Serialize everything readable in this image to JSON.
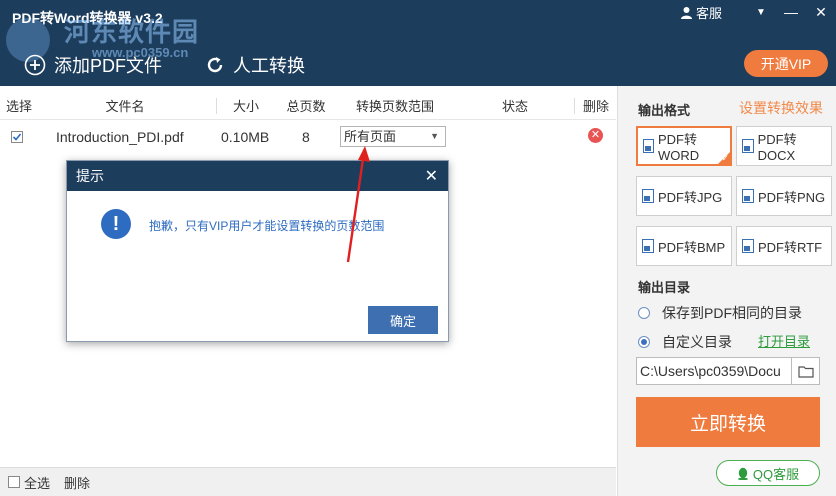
{
  "app": {
    "title": "PDF转Word转换器 v3.2",
    "watermark": "河东软件园",
    "watermark_url": "www.pc0359.cn"
  },
  "titlebar": {
    "kefu_label": "客服",
    "menu_icon": "▼",
    "minimize_icon": "—",
    "close_icon": "✕"
  },
  "toolbar": {
    "add_pdf_label": "添加PDF文件",
    "manual_convert_label": "人工转换",
    "vip_label": "开通VIP"
  },
  "table": {
    "headers": [
      "选择",
      "文件名",
      "大小",
      "总页数",
      "转换页数范围",
      "状态",
      "删除"
    ],
    "rows": [
      {
        "checked": true,
        "filename": "Introduction_PDI.pdf",
        "size": "0.10MB",
        "pages": "8",
        "range": "所有页面",
        "status": ""
      }
    ]
  },
  "footer": {
    "select_all_label": "全选",
    "delete_label": "删除"
  },
  "right_panel": {
    "output_format_label": "输出格式",
    "settings_link": "设置转换效果",
    "formats": [
      "PDF转WORD",
      "PDF转DOCX",
      "PDF转JPG",
      "PDF转PNG",
      "PDF转BMP",
      "PDF转RTF"
    ],
    "selected_format": "PDF转WORD",
    "output_dir_label": "输出目录",
    "option_same_dir": "保存到PDF相同的目录",
    "option_custom_dir": "自定义目录",
    "open_dir_link": "打开目录",
    "path_value": "C:\\Users\\pc0359\\Docu",
    "convert_button": "立即转换",
    "qq_button": "QQ客服"
  },
  "dialog": {
    "title": "提示",
    "message": "抱歉，只有VIP用户才能设置转换的页数范围",
    "ok_label": "确定"
  },
  "colors": {
    "header_bg": "#1c3d5c",
    "accent_orange": "#f07b3f",
    "link_blue": "#2d6cc0",
    "qq_green": "#4caf50"
  }
}
